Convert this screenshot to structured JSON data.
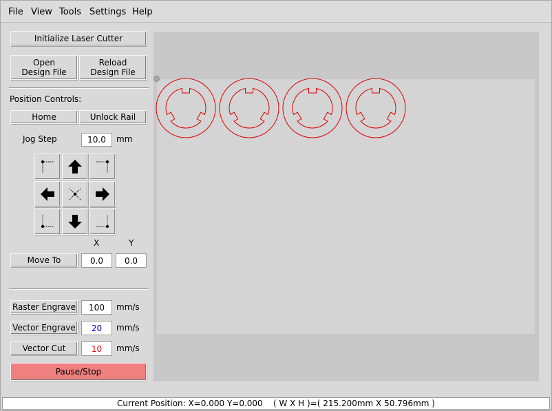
{
  "menu": [
    "File",
    "View",
    "Tools",
    "Settings",
    "Help"
  ],
  "buttons": {
    "initialize": "Initialize Laser Cutter",
    "open_design": "Open\nDesign File",
    "reload_design": "Reload\nDesign File",
    "home": "Home",
    "unlock_rail": "Unlock Rail",
    "move_to": "Move To",
    "raster_engrave": "Raster Engrave",
    "vector_engrave": "Vector Engrave",
    "vector_cut": "Vector Cut",
    "pause_stop": "Pause/Stop"
  },
  "labels": {
    "position_controls": "Position Controls:",
    "jog_step": "Jog Step",
    "mm": "mm",
    "x": "X",
    "y": "Y",
    "mms": "mm/s"
  },
  "values": {
    "jog_step": "10.0",
    "move_x": "0.0",
    "move_y": "0.0",
    "raster_speed": "100",
    "vector_engrave_speed": "20",
    "vector_cut_speed": "10"
  },
  "jog_icons": [
    "jog-up-left-icon",
    "arrow-up-icon",
    "jog-up-right-icon",
    "arrow-left-icon",
    "jog-center-icon",
    "arrow-right-icon",
    "jog-down-left-icon",
    "arrow-down-icon",
    "jog-down-right-icon"
  ],
  "colors": {
    "pause_button": "#f08080",
    "design_stroke": "#e00000",
    "vector_engrave_text": "#0000cc",
    "vector_cut_text": "#e00000"
  },
  "status": {
    "text": "Current Position: X=0.000 Y=0.000    ( W X H )=( 215.200mm X 50.796mm )"
  },
  "design": {
    "part_count": 4
  }
}
